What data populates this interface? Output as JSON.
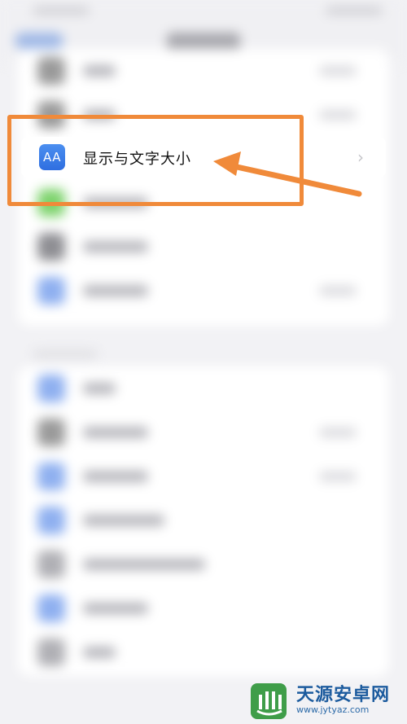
{
  "focused_row": {
    "icon_text": "AA",
    "label": "显示与文字大小",
    "chevron": "›"
  },
  "annotation": {
    "box_color": "#f08a3a",
    "arrow_color": "#f08a3a"
  },
  "blurred_rows_group1": [
    {
      "icon_color": "#9a9a9a",
      "has_value": true
    },
    {
      "icon_color": "#9a9a9a",
      "has_value": true
    },
    {
      "icon_color": "#5f6fd6",
      "has_value": false
    },
    {
      "icon_color": "#7ed36d",
      "has_value": false
    },
    {
      "icon_color": "#8e8e93",
      "has_value": false
    },
    {
      "icon_color": "#8fb0f0",
      "has_value": true
    }
  ],
  "blurred_rows_group2": [
    {
      "icon_color": "#8fb0f0",
      "has_value": false
    },
    {
      "icon_color": "#9a9a9a",
      "has_value": true
    },
    {
      "icon_color": "#8fb0f0",
      "has_value": true
    },
    {
      "icon_color": "#8fb0f0",
      "has_value": false
    },
    {
      "icon_color": "#b0b0b5",
      "has_value": false
    },
    {
      "icon_color": "#8fb0f0",
      "has_value": false
    },
    {
      "icon_color": "#b0b0b5",
      "has_value": false
    }
  ],
  "watermark": {
    "title": "天源安卓网",
    "url": "www.jytyaz.com",
    "logo_icon": "android-logo-icon",
    "logo_color": "#3f9d49"
  }
}
